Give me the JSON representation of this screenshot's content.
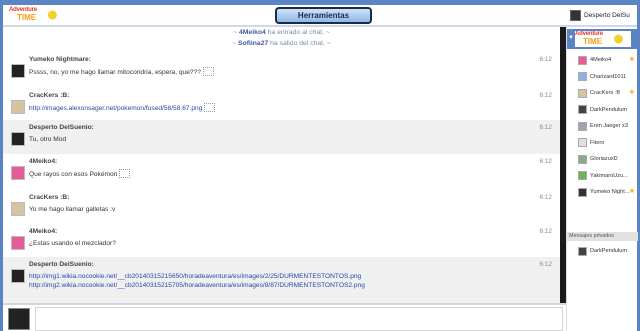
{
  "header": {
    "logo_top": "Adventure",
    "logo_bottom": "TIME",
    "tools_button": "Herramientas",
    "current_user": "Desperto DelSu"
  },
  "system_messages": [
    {
      "user": "4Meiko4",
      "text": " ha entrado al chat."
    },
    {
      "user": "Sofiina27",
      "text": " ha salido del chat."
    }
  ],
  "messages": [
    {
      "user": "Yumeko Nightmare:",
      "time": "6:12",
      "lines": [
        "Pssss, no, yo me hago llamar mitocondria, espera, que???"
      ]
    },
    {
      "user": "CracKers :B:",
      "time": "6:12",
      "link": "http://images.alexonsager.net/pokemon/fused/58/58.67.png"
    },
    {
      "user": "Desperto DelSuenio:",
      "time": "6:12",
      "lines": [
        "Tu, otro Mod"
      ]
    },
    {
      "user": "4Meiko4:",
      "time": "6:12",
      "lines": [
        "Que rayos con esos Pokémon"
      ]
    },
    {
      "user": "CracKers :B:",
      "time": "6:12",
      "lines": [
        "Yo me hago llamar galletas :v"
      ]
    },
    {
      "user": "4Meiko4:",
      "time": "6:12",
      "lines": [
        "¿Estas usando el mezclador?"
      ]
    },
    {
      "user": "Desperto DelSuenio:",
      "time": "6:12",
      "links": [
        "http://img1.wikia.nocookie.net/__cb20140315215650/horadeaventura/es/images/2/25/DURMENTESTONTOS.png",
        "http://img2.wikia.nocookie.net/__cb20140315215705/horadeaventura/es/images/8/87/DURMENTESTONTOS2.png"
      ]
    }
  ],
  "sidebar": {
    "users": [
      {
        "name": "4Meiko4",
        "star": true,
        "color": "#e85a9a"
      },
      {
        "name": "Charizard1011",
        "star": false,
        "color": "#8fb0e0"
      },
      {
        "name": "CracKers :B",
        "star": true,
        "color": "#d6c3a0"
      },
      {
        "name": "DarkPendulum",
        "star": false,
        "color": "#444444"
      },
      {
        "name": "Eren Jaeger x3",
        "star": false,
        "color": "#9aa5b0"
      },
      {
        "name": "Fitero",
        "star": false,
        "color": "#e0e0e0"
      },
      {
        "name": "GloriazuxD",
        "star": false,
        "color": "#8aa88a"
      },
      {
        "name": "YakimaroUzu...",
        "star": false,
        "color": "#6db35a"
      },
      {
        "name": "Yumeko Night...",
        "star": true,
        "color": "#333333"
      }
    ],
    "private_title": "Mensajes privados",
    "private_users": [
      {
        "name": "DarkPendulum",
        "color": "#444444"
      }
    ]
  }
}
